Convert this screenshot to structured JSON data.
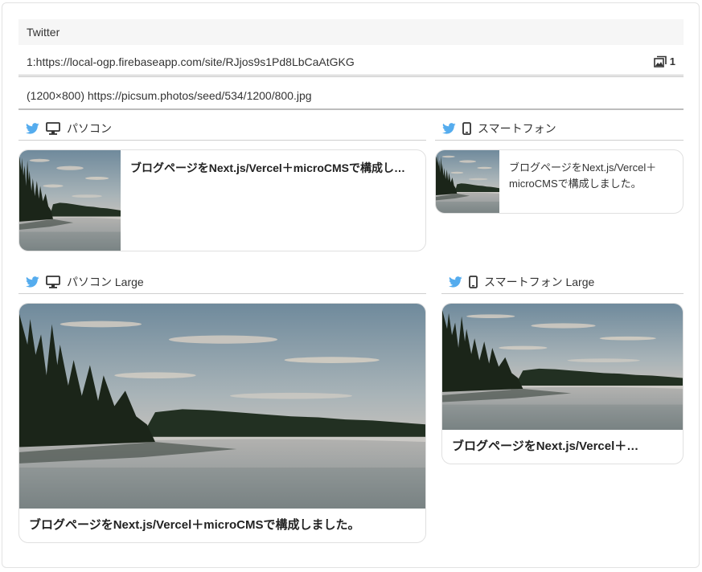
{
  "section": {
    "title": "Twitter"
  },
  "url_row": {
    "text": "1:https://local-ogp.firebaseapp.com/site/RJjos9s1Pd8LbCaAtGKG",
    "image_count": "1"
  },
  "image_row": {
    "text": "(1200×800) https://picsum.photos/seed/534/1200/800.jpg"
  },
  "previews": {
    "pc": {
      "label": "パソコン"
    },
    "sp": {
      "label": "スマートフォン"
    },
    "pc_large": {
      "label": "パソコン Large"
    },
    "sp_large": {
      "label": "スマートフォン Large"
    }
  },
  "card": {
    "title_truncated_pc": "ブログページをNext.js/Vercel＋microCMSで構成し…",
    "title_sp": "ブログページをNext.js/Vercel＋microCMSで構成しました。",
    "title_truncated_sp_large": "ブログページをNext.js/Vercel＋…",
    "title_full": "ブログページをNext.js/Vercel＋microCMSで構成しました。"
  },
  "colors": {
    "twitter": "#55acee",
    "border": "#e0e0e0",
    "header_bg": "#f6f6f6"
  },
  "icons": [
    "twitter-icon",
    "desktop-icon",
    "smartphone-icon",
    "images-icon"
  ]
}
